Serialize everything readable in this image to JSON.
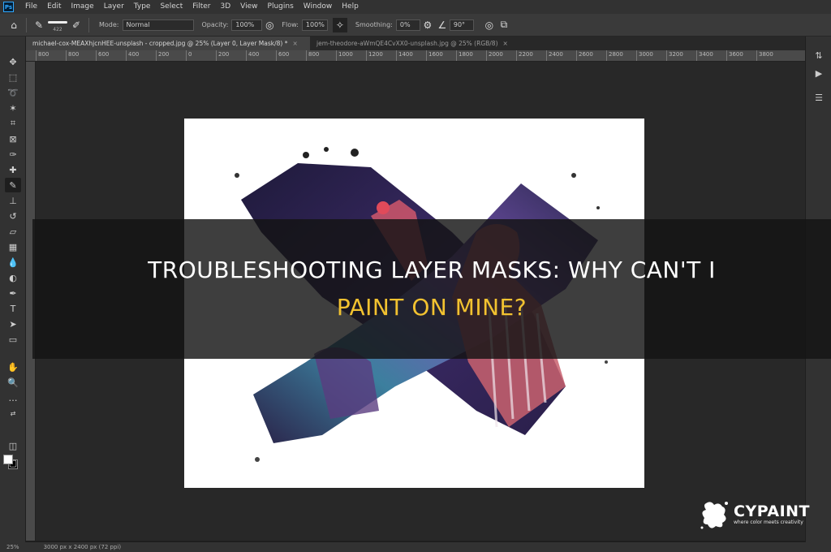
{
  "menu": {
    "logo": "Ps",
    "items": [
      "File",
      "Edit",
      "Image",
      "Layer",
      "Type",
      "Select",
      "Filter",
      "3D",
      "View",
      "Plugins",
      "Window",
      "Help"
    ]
  },
  "options": {
    "brush_size": "422",
    "mode_label": "Mode:",
    "mode_value": "Normal",
    "opacity_label": "Opacity:",
    "opacity_value": "100%",
    "flow_label": "Flow:",
    "flow_value": "100%",
    "smoothing_label": "Smoothing:",
    "smoothing_value": "0%",
    "angle_value": "90°"
  },
  "tabs": [
    {
      "label": "michael-cox-MEAXhjcnHEE-unsplash - cropped.jpg @ 25% (Layer 0, Layer Mask/8) *",
      "close": "×"
    },
    {
      "label": "jem-theodore-aWmQE4CvXX0-unsplash.jpg @ 25% (RGB/8)",
      "close": "×"
    }
  ],
  "ruler": {
    "ticks": [
      "800",
      "800",
      "600",
      "400",
      "200",
      "0",
      "200",
      "400",
      "600",
      "800",
      "1000",
      "1200",
      "1400",
      "1600",
      "1800",
      "2000",
      "2200",
      "2400",
      "2600",
      "2800",
      "3000",
      "3200",
      "3400",
      "3600",
      "3800"
    ]
  },
  "colors": {
    "foreground": "#ffffff",
    "background": "#000000",
    "title_white": "#ffffff",
    "title_accent": "#f2c230"
  },
  "status": {
    "zoom": "25%",
    "doc_info": "3000 px x 2400 px (72 ppi)"
  },
  "title": {
    "line1": "TROUBLESHOOTING LAYER MASKS: WHY CAN'T I",
    "line2": "PAINT ON MINE?"
  },
  "logo": {
    "name": "CYPAINT",
    "tagline": "where color meets creativity"
  }
}
